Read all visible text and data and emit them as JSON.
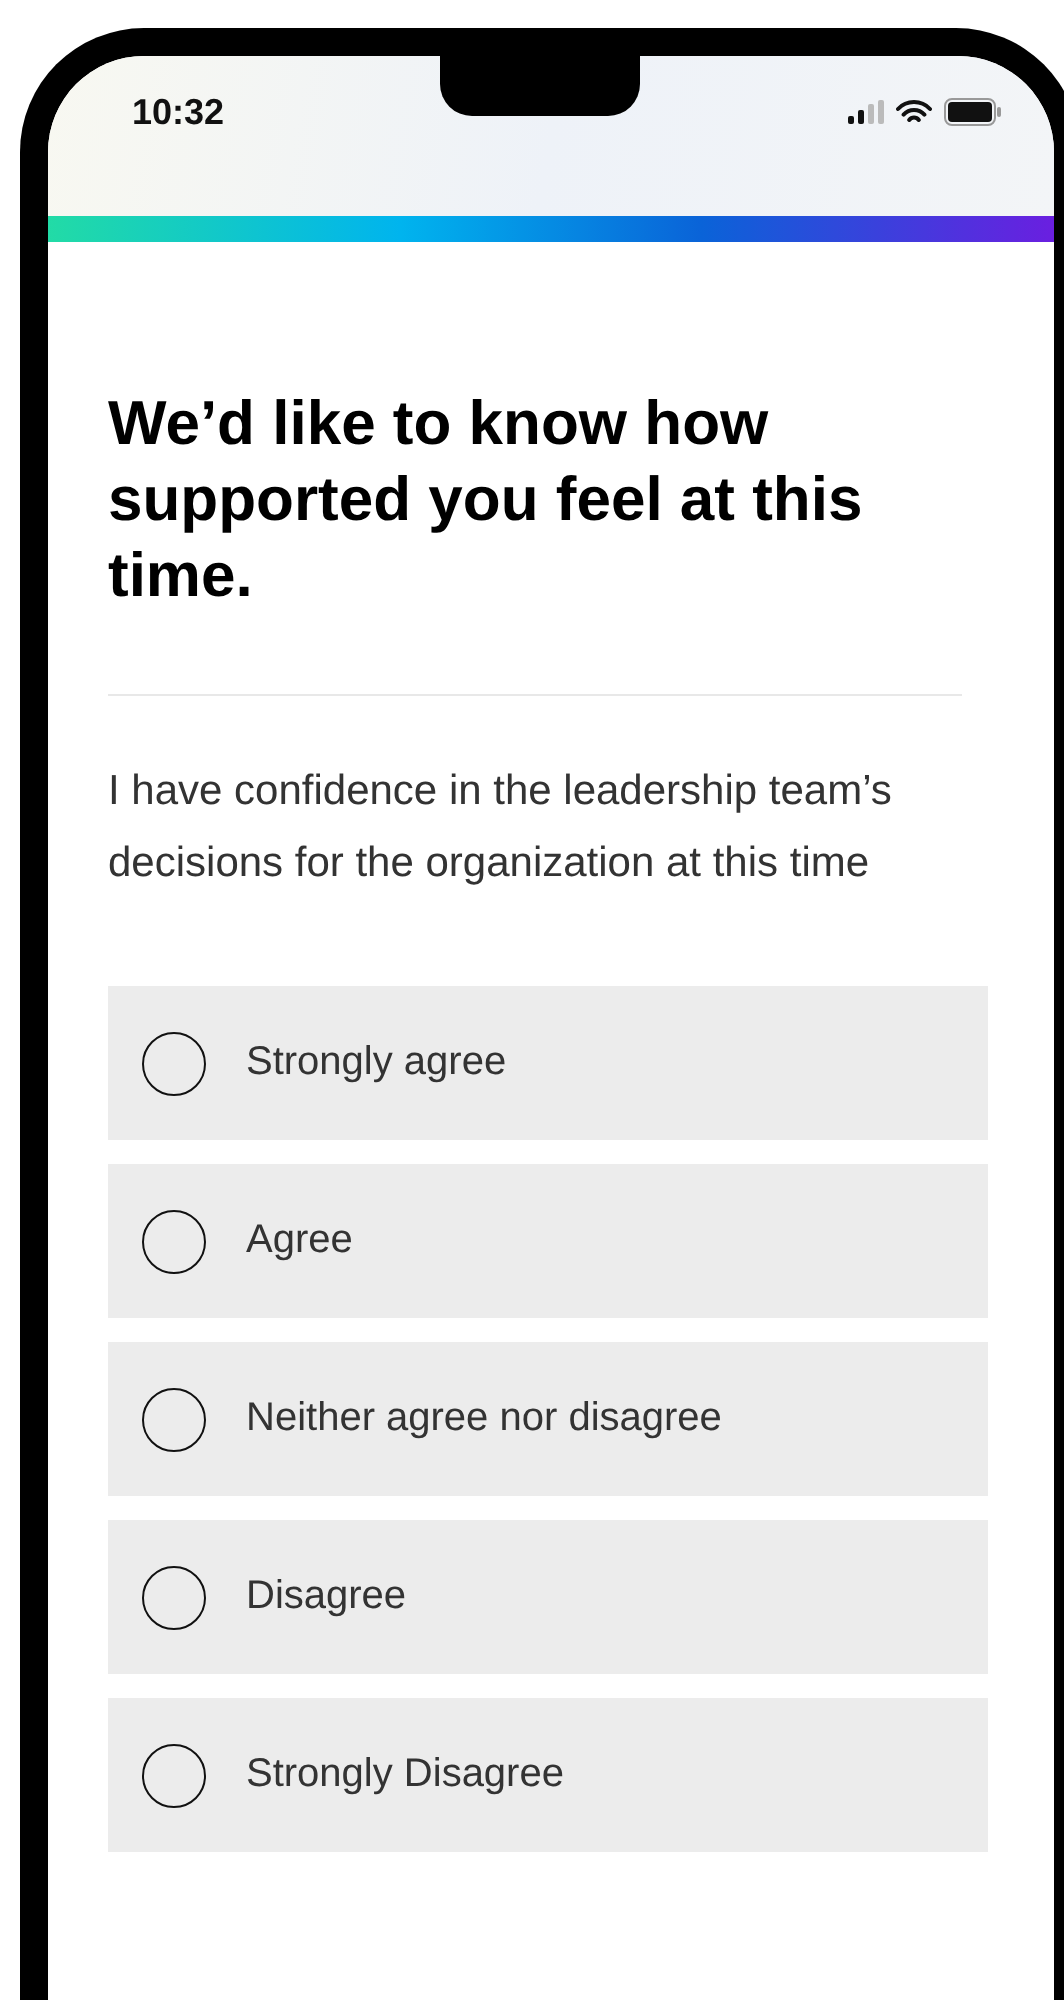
{
  "status_bar": {
    "time": "10:32"
  },
  "title": "We’d like to know how supported you feel at this time.",
  "question": "I have confidence in the leadership team’s decisions for the organization at this time",
  "options": [
    {
      "label": "Strongly agree",
      "selected": false
    },
    {
      "label": "Agree",
      "selected": false
    },
    {
      "label": "Neither agree nor disagree",
      "selected": false
    },
    {
      "label": "Disagree",
      "selected": false
    },
    {
      "label": "Strongly Disagree",
      "selected": false
    }
  ]
}
